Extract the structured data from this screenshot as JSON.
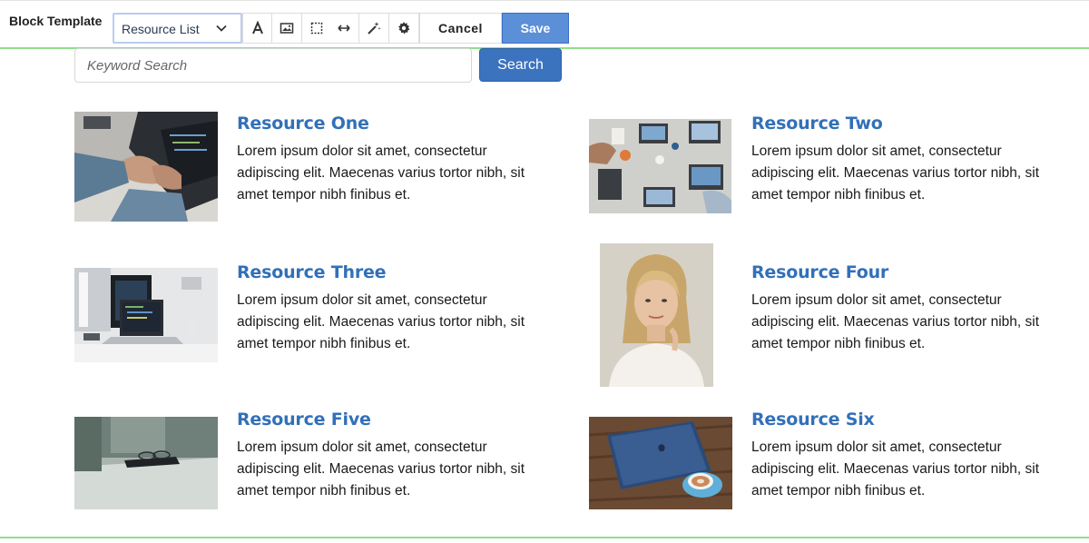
{
  "toolbar": {
    "label": "Block Template",
    "select_value": "Resource List",
    "buttons": [
      {
        "icon": "text-format-icon"
      },
      {
        "icon": "image-icon"
      },
      {
        "icon": "selection-box-icon"
      },
      {
        "icon": "width-arrows-icon"
      },
      {
        "icon": "magic-wand-icon"
      },
      {
        "icon": "gear-icon"
      }
    ],
    "cancel_label": "Cancel",
    "save_label": "Save"
  },
  "search": {
    "placeholder": "Keyword Search",
    "button_label": "Search"
  },
  "resources": [
    {
      "title": "Resource One",
      "text": "Lorem ipsum dolor sit amet, consectetur adipiscing elit. Maecenas varius tortor nibh, sit amet tempor nibh finibus et.",
      "image": "laptop-typing-photo"
    },
    {
      "title": "Resource Two",
      "text": "Lorem ipsum dolor sit amet, consectetur adipiscing elit. Maecenas varius tortor nibh, sit amet tempor nibh finibus et.",
      "image": "team-desk-overhead-photo"
    },
    {
      "title": "Resource Three",
      "text": "Lorem ipsum dolor sit amet, consectetur adipiscing elit. Maecenas varius tortor nibh, sit amet tempor nibh finibus et.",
      "image": "workspace-laptop-photo"
    },
    {
      "title": "Resource Four",
      "text": "Lorem ipsum dolor sit amet, consectetur adipiscing elit. Maecenas varius tortor nibh, sit amet tempor nibh finibus et.",
      "image": "woman-portrait-photo"
    },
    {
      "title": "Resource Five",
      "text": "Lorem ipsum dolor sit amet, consectetur adipiscing elit. Maecenas varius tortor nibh, sit amet tempor nibh finibus et.",
      "image": "glasses-phone-desk-photo"
    },
    {
      "title": "Resource Six",
      "text": "Lorem ipsum dolor sit amet, consectetur adipiscing elit. Maecenas varius tortor nibh, sit amet tempor nibh finibus et.",
      "image": "laptop-coffee-photo"
    }
  ],
  "colors": {
    "accent": "#3270b8",
    "save_button": "#5b8fd8",
    "search_button": "#3b73bf",
    "guide_line": "#8fe08a"
  }
}
